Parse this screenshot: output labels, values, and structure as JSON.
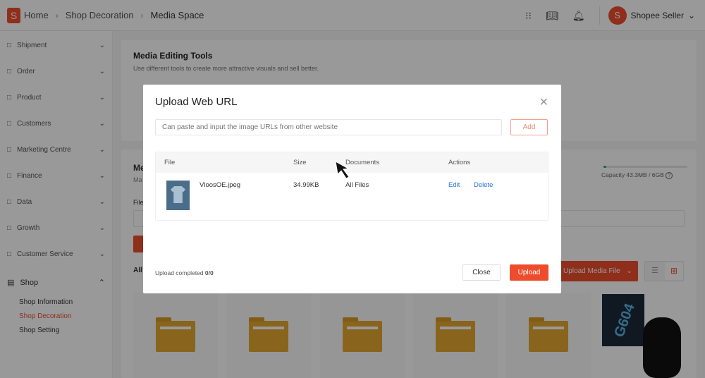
{
  "header": {
    "breadcrumb": [
      "Home",
      "Shop Decoration",
      "Media Space"
    ],
    "user": "Shopee Seller",
    "logo_letter": "S"
  },
  "sidebar": {
    "items": [
      "Shipment",
      "Order",
      "Product",
      "Customers",
      "Marketing Centre",
      "Finance",
      "Data",
      "Growth",
      "Customer Service"
    ],
    "shop": {
      "label": "Shop",
      "subitems": [
        "Shop Information",
        "Shop Decoration",
        "Shop Setting"
      ],
      "active": "Shop Decoration"
    }
  },
  "tools_card": {
    "title": "Media Editing Tools",
    "subtitle": "Use different tools to create more attractive visuals and sell better."
  },
  "media_card": {
    "title_fragment": "Me",
    "subtitle_fragment": "Ma",
    "filter_label_fragment": "File",
    "all_fragment": "All",
    "capacity": "Capacity 43.3MB / 6GB",
    "capacity_used_fraction": 0.007,
    "upload_button": "Upload Media File",
    "folder_count": 5,
    "product_label": "G604"
  },
  "modal": {
    "title": "Upload Web URL",
    "url_placeholder": "Can paste and input the image URLs from other website",
    "add_label": "Add",
    "columns": [
      "File",
      "Size",
      "Documents",
      "Actions"
    ],
    "rows": [
      {
        "file": "VloosOE.jpeg",
        "size": "34.99KB",
        "documents": "All Files",
        "edit": "Edit",
        "delete": "Delete"
      }
    ],
    "status_label": "Upload completed",
    "status_count": "0/0",
    "close_label": "Close",
    "upload_label": "Upload"
  },
  "colors": {
    "accent": "#ee4d2d",
    "link": "#2673dd",
    "capacity": "#26aa5a"
  }
}
